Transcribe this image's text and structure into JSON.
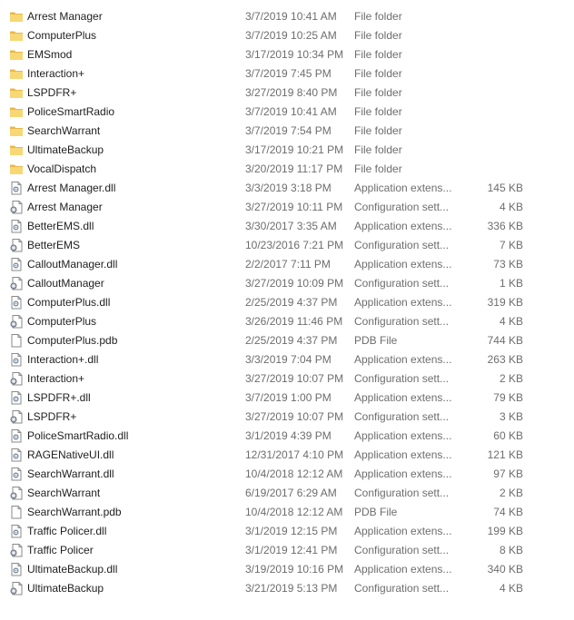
{
  "colors": {
    "folder_body": "#f8d775",
    "folder_tab": "#e8b84a",
    "name_text": "#1e1e1e",
    "meta_text": "#6d6d6d"
  },
  "files": [
    {
      "icon": "folder-icon",
      "name": "Arrest Manager",
      "date": "3/7/2019 10:41 AM",
      "type": "File folder",
      "size": ""
    },
    {
      "icon": "folder-icon",
      "name": "ComputerPlus",
      "date": "3/7/2019 10:25 AM",
      "type": "File folder",
      "size": ""
    },
    {
      "icon": "folder-icon",
      "name": "EMSmod",
      "date": "3/17/2019 10:34 PM",
      "type": "File folder",
      "size": ""
    },
    {
      "icon": "folder-icon",
      "name": "Interaction+",
      "date": "3/7/2019 7:45 PM",
      "type": "File folder",
      "size": ""
    },
    {
      "icon": "folder-icon",
      "name": "LSPDFR+",
      "date": "3/27/2019 8:40 PM",
      "type": "File folder",
      "size": ""
    },
    {
      "icon": "folder-icon",
      "name": "PoliceSmartRadio",
      "date": "3/7/2019 10:41 AM",
      "type": "File folder",
      "size": ""
    },
    {
      "icon": "folder-icon",
      "name": "SearchWarrant",
      "date": "3/7/2019 7:54 PM",
      "type": "File folder",
      "size": ""
    },
    {
      "icon": "folder-icon",
      "name": "UltimateBackup",
      "date": "3/17/2019 10:21 PM",
      "type": "File folder",
      "size": ""
    },
    {
      "icon": "folder-icon",
      "name": "VocalDispatch",
      "date": "3/20/2019 11:17 PM",
      "type": "File folder",
      "size": ""
    },
    {
      "icon": "dll-file-icon",
      "name": "Arrest Manager.dll",
      "date": "3/3/2019 3:18 PM",
      "type": "Application extens...",
      "size": "145 KB"
    },
    {
      "icon": "config-file-icon",
      "name": "Arrest Manager",
      "date": "3/27/2019 10:11 PM",
      "type": "Configuration sett...",
      "size": "4 KB"
    },
    {
      "icon": "dll-file-icon",
      "name": "BetterEMS.dll",
      "date": "3/30/2017 3:35 AM",
      "type": "Application extens...",
      "size": "336 KB"
    },
    {
      "icon": "config-file-icon",
      "name": "BetterEMS",
      "date": "10/23/2016 7:21 PM",
      "type": "Configuration sett...",
      "size": "7 KB"
    },
    {
      "icon": "dll-file-icon",
      "name": "CalloutManager.dll",
      "date": "2/2/2017 7:11 PM",
      "type": "Application extens...",
      "size": "73 KB"
    },
    {
      "icon": "config-file-icon",
      "name": "CalloutManager",
      "date": "3/27/2019 10:09 PM",
      "type": "Configuration sett...",
      "size": "1 KB"
    },
    {
      "icon": "dll-file-icon",
      "name": "ComputerPlus.dll",
      "date": "2/25/2019 4:37 PM",
      "type": "Application extens...",
      "size": "319 KB"
    },
    {
      "icon": "config-file-icon",
      "name": "ComputerPlus",
      "date": "3/26/2019 11:46 PM",
      "type": "Configuration sett...",
      "size": "4 KB"
    },
    {
      "icon": "blank-file-icon",
      "name": "ComputerPlus.pdb",
      "date": "2/25/2019 4:37 PM",
      "type": "PDB File",
      "size": "744 KB"
    },
    {
      "icon": "dll-file-icon",
      "name": "Interaction+.dll",
      "date": "3/3/2019 7:04 PM",
      "type": "Application extens...",
      "size": "263 KB"
    },
    {
      "icon": "config-file-icon",
      "name": "Interaction+",
      "date": "3/27/2019 10:07 PM",
      "type": "Configuration sett...",
      "size": "2 KB"
    },
    {
      "icon": "dll-file-icon",
      "name": "LSPDFR+.dll",
      "date": "3/7/2019 1:00 PM",
      "type": "Application extens...",
      "size": "79 KB"
    },
    {
      "icon": "config-file-icon",
      "name": "LSPDFR+",
      "date": "3/27/2019 10:07 PM",
      "type": "Configuration sett...",
      "size": "3 KB"
    },
    {
      "icon": "dll-file-icon",
      "name": "PoliceSmartRadio.dll",
      "date": "3/1/2019 4:39 PM",
      "type": "Application extens...",
      "size": "60 KB"
    },
    {
      "icon": "dll-file-icon",
      "name": "RAGENativeUI.dll",
      "date": "12/31/2017 4:10 PM",
      "type": "Application extens...",
      "size": "121 KB"
    },
    {
      "icon": "dll-file-icon",
      "name": "SearchWarrant.dll",
      "date": "10/4/2018 12:12 AM",
      "type": "Application extens...",
      "size": "97 KB"
    },
    {
      "icon": "config-file-icon",
      "name": "SearchWarrant",
      "date": "6/19/2017 6:29 AM",
      "type": "Configuration sett...",
      "size": "2 KB"
    },
    {
      "icon": "blank-file-icon",
      "name": "SearchWarrant.pdb",
      "date": "10/4/2018 12:12 AM",
      "type": "PDB File",
      "size": "74 KB"
    },
    {
      "icon": "dll-file-icon",
      "name": "Traffic Policer.dll",
      "date": "3/1/2019 12:15 PM",
      "type": "Application extens...",
      "size": "199 KB"
    },
    {
      "icon": "config-file-icon",
      "name": "Traffic Policer",
      "date": "3/1/2019 12:41 PM",
      "type": "Configuration sett...",
      "size": "8 KB"
    },
    {
      "icon": "dll-file-icon",
      "name": "UltimateBackup.dll",
      "date": "3/19/2019 10:16 PM",
      "type": "Application extens...",
      "size": "340 KB"
    },
    {
      "icon": "config-file-icon",
      "name": "UltimateBackup",
      "date": "3/21/2019 5:13 PM",
      "type": "Configuration sett...",
      "size": "4 KB"
    }
  ]
}
